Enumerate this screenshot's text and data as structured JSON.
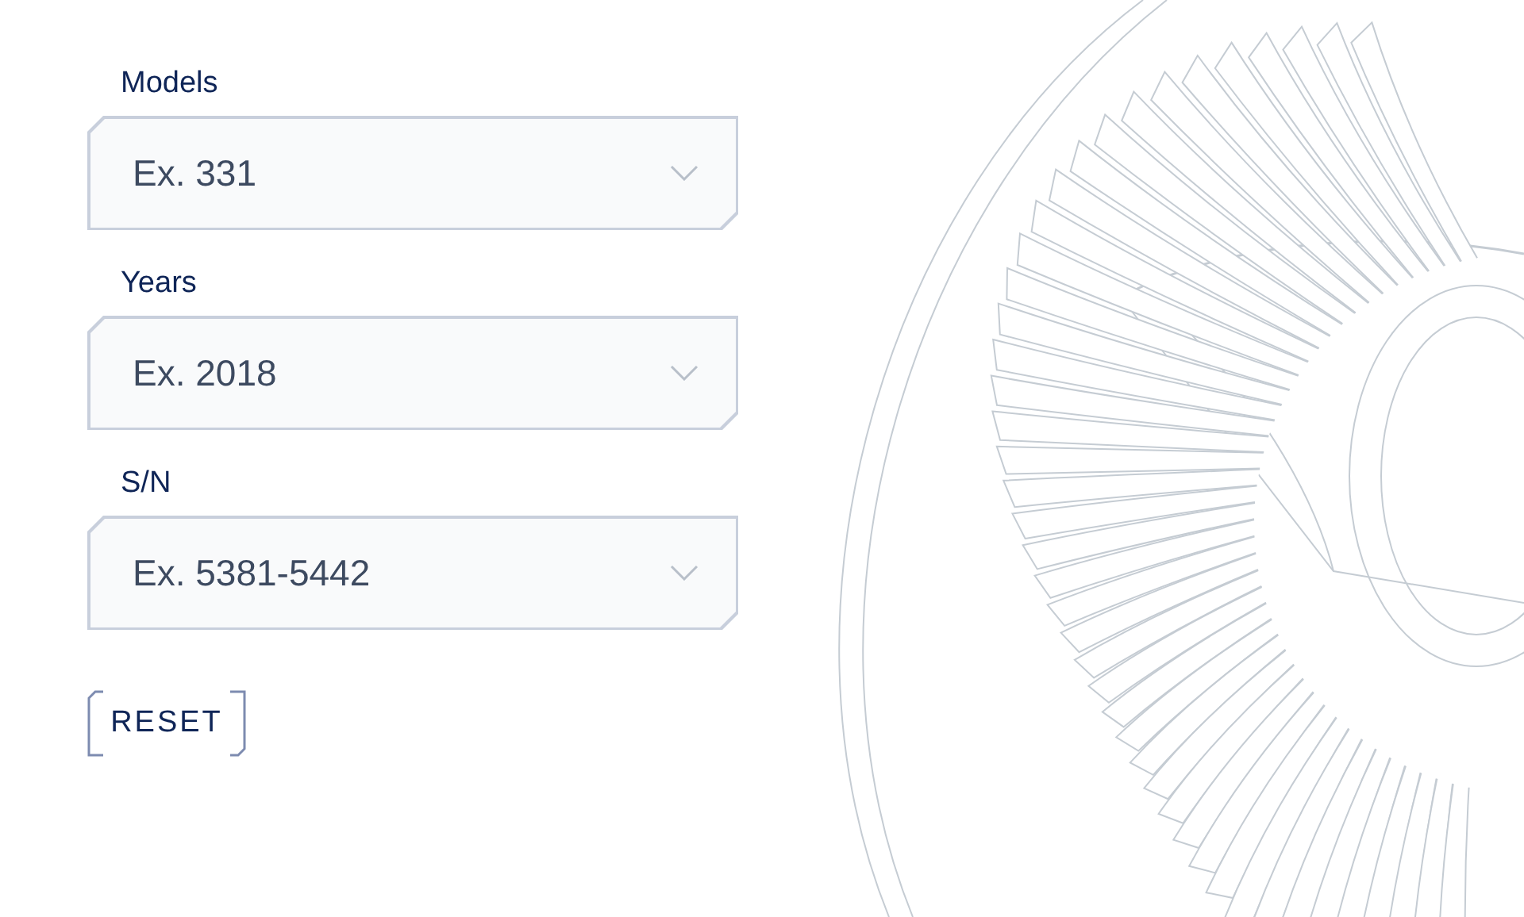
{
  "filters": [
    {
      "label": "Models",
      "placeholder": "Ex. 331"
    },
    {
      "label": "Years",
      "placeholder": "Ex. 2018"
    },
    {
      "label": "S/N",
      "placeholder": "Ex. 5381-5442"
    }
  ],
  "reset_button": {
    "label": "RESET"
  }
}
